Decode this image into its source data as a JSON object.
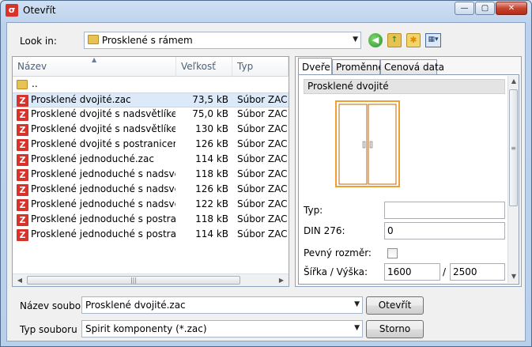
{
  "window": {
    "title": "Otevřít",
    "app_icon_letter": "σ"
  },
  "window_controls": {
    "minimize": "—",
    "maximize": "▢",
    "close": "✕"
  },
  "lookin": {
    "label": "Look in:",
    "value": "Prosklené s rámem",
    "toolbar": {
      "back_icon": "◀",
      "up_icon": "↑",
      "new_folder_icon": "✱",
      "view_icon": "▦▾"
    }
  },
  "filelist": {
    "sort_indicator": "▲",
    "columns": {
      "name": "Název",
      "size": "Veľkosť",
      "type": "Typ"
    },
    "parent_folder": "..",
    "file_icon_letter": "Z",
    "selected_index": 0,
    "files": [
      {
        "name": "Prosklené dvojité.zac",
        "size": "73,5 kB",
        "type": "Súbor ZAC"
      },
      {
        "name": "Prosklené dvojité s nadsvětlíkem...",
        "size": "75,0 kB",
        "type": "Súbor ZAC"
      },
      {
        "name": "Prosklené dvojité s nadsvětlíkem...",
        "size": "130 kB",
        "type": "Súbor ZAC"
      },
      {
        "name": "Prosklené dvojité s postranicemi...",
        "size": "126 kB",
        "type": "Súbor ZAC"
      },
      {
        "name": "Prosklené jednoduché.zac",
        "size": "114 kB",
        "type": "Súbor ZAC"
      },
      {
        "name": "Prosklené jednoduché s nadsvětl...",
        "size": "118 kB",
        "type": "Súbor ZAC"
      },
      {
        "name": "Prosklené jednoduché s nadsvětl...",
        "size": "126 kB",
        "type": "Súbor ZAC"
      },
      {
        "name": "Prosklené jednoduché s nadsvětl...",
        "size": "122 kB",
        "type": "Súbor ZAC"
      },
      {
        "name": "Prosklené jednoduché s postrani...",
        "size": "118 kB",
        "type": "Súbor ZAC"
      },
      {
        "name": "Prosklené jednoduché s postrani...",
        "size": "114 kB",
        "type": "Súbor ZAC"
      }
    ],
    "hscroll": {
      "left": "◀",
      "right": "▶",
      "grip": "|||"
    }
  },
  "preview": {
    "tabs": [
      "Dveře",
      "Proměnné",
      "Cenová data"
    ],
    "active_tab": 0,
    "part_name": "Prosklené dvojité",
    "fields": {
      "typ_label": "Typ:",
      "typ_value": "",
      "din_label": "DIN 276:",
      "din_value": "0",
      "fixed_label": "Pevný rozměr:",
      "fixed_checked": false,
      "size_label": "Šířka / Výška:",
      "width": "1600",
      "separator": "/",
      "height": "2500"
    },
    "vscroll": {
      "up": "▲",
      "down": "▼",
      "grip": "≡"
    },
    "door_colors": {
      "frame": "#f0a030",
      "frame_dark": "#b86a10",
      "glass": "#ffffff"
    }
  },
  "bottom": {
    "filename_label": "Název souboru",
    "filename_value": "Prosklené dvojité.zac",
    "filetype_label": "Typ souboru",
    "filetype_value": "Spirit komponenty (*.zac)",
    "open_button": "Otevřít",
    "cancel_button": "Storno"
  },
  "dropdown_arrow": "▼"
}
